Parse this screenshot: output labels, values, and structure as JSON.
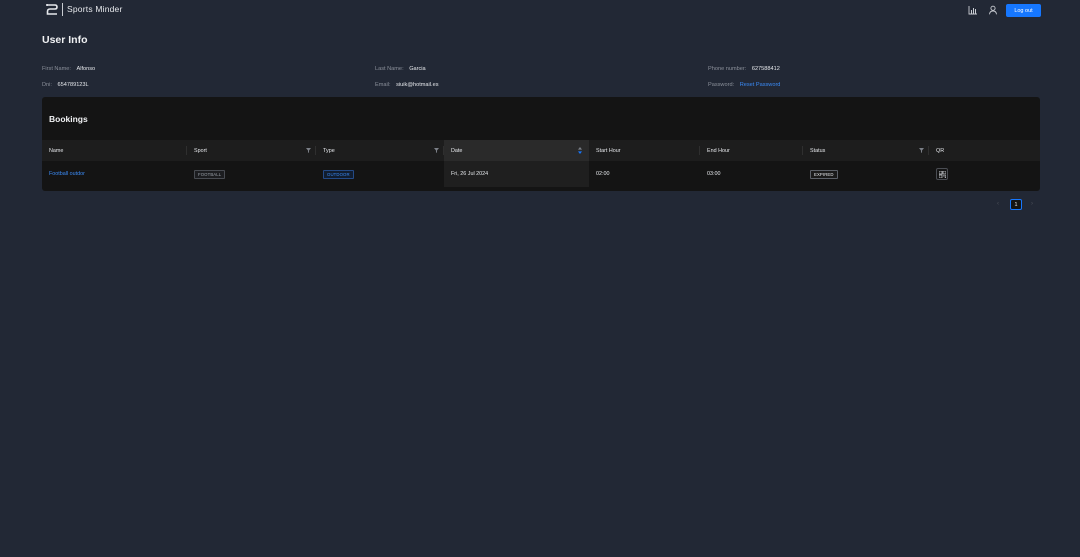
{
  "header": {
    "brand": "Sports Minder",
    "logout_label": "Log out",
    "icons": [
      "bar-chart-icon",
      "user-icon"
    ]
  },
  "user_info": {
    "title": "User Info",
    "first_name": {
      "label": "First Name",
      "value": "Alfonso"
    },
    "last_name": {
      "label": "Last Name",
      "value": "Garcia"
    },
    "phone": {
      "label": "Phone number",
      "value": "627588412"
    },
    "dni": {
      "label": "Dni",
      "value": "654789123L"
    },
    "email": {
      "label": "Email",
      "value": "siuik@hotmail.es"
    },
    "password": {
      "label": "Password",
      "link": "Reset Password"
    }
  },
  "bookings": {
    "title": "Bookings",
    "columns": [
      "Name",
      "Sport",
      "Type",
      "Date",
      "Start Hour",
      "End Hour",
      "Status",
      "QR"
    ],
    "rows": [
      {
        "name": "Football outdor",
        "sport": "FOOTBALL",
        "type": "OUTDOOR",
        "date": "Fri, 26 Jul 2024",
        "start_hour": "02:00",
        "end_hour": "03:00",
        "status": "EXPIRED"
      }
    ]
  },
  "pagination": {
    "current_page": "1",
    "prev": "‹",
    "next": "›"
  },
  "colors": {
    "background": "#222835",
    "card": "#141414",
    "accent": "#1677ff",
    "link": "#3b8bf6"
  }
}
